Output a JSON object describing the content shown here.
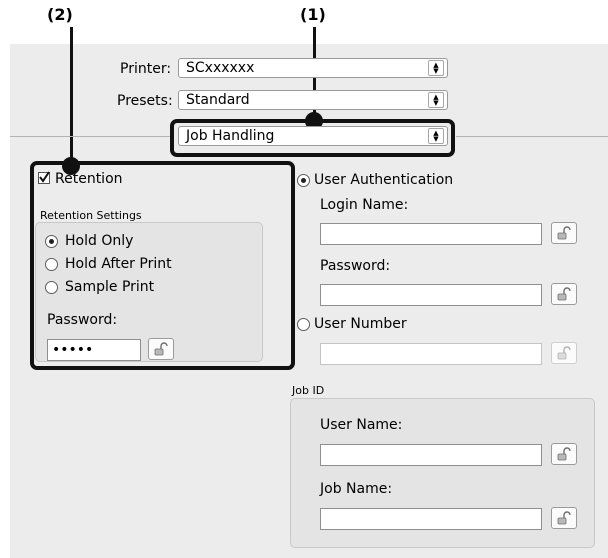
{
  "callouts": {
    "one": "(1)",
    "two": "(2)"
  },
  "printer": {
    "label": "Printer:",
    "value": "SCxxxxxx"
  },
  "presets": {
    "label": "Presets:",
    "value": "Standard"
  },
  "panel_menu": {
    "value": "Job Handling"
  },
  "retention": {
    "checkbox_label": "Retention",
    "checked": true,
    "settings_title": "Retention Settings",
    "options": [
      "Hold Only",
      "Hold After Print",
      "Sample Print"
    ],
    "selected": "Hold Only",
    "password_label": "Password:",
    "password_value": "•••••"
  },
  "authentication": {
    "user_auth_label": "User Authentication",
    "login_name_label": "Login Name:",
    "login_name_value": "",
    "password_label": "Password:",
    "password_value": "",
    "user_number_label": "User Number",
    "user_number_value": "",
    "selected": "User Authentication"
  },
  "job_id": {
    "title": "Job ID",
    "user_name_label": "User Name:",
    "user_name_value": "",
    "job_name_label": "Job Name:",
    "job_name_value": ""
  },
  "icons": {
    "lock": "padlock-icon",
    "popup_arrows": "up-down-arrows-icon"
  }
}
